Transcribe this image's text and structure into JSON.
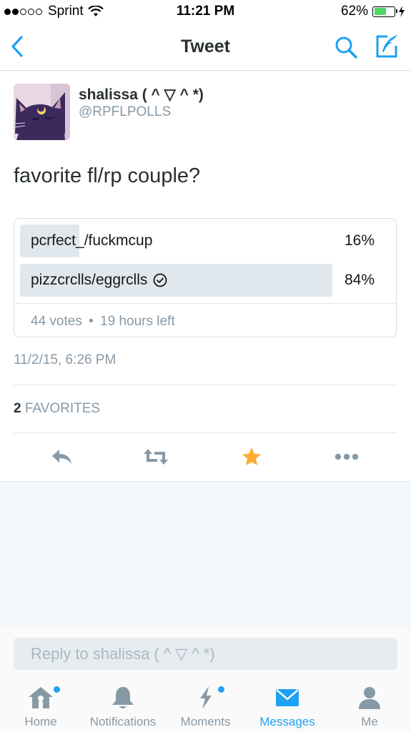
{
  "status_bar": {
    "carrier": "Sprint",
    "time": "11:21 PM",
    "battery_percent": "62%",
    "battery_level": 0.62,
    "signal_bars_filled": 2,
    "signal_bars_total": 5
  },
  "nav": {
    "title": "Tweet",
    "back_icon": "chevron-left-icon",
    "search_icon": "search-icon",
    "compose_icon": "compose-icon",
    "accent_color": "#1da1f2"
  },
  "tweet": {
    "display_name": "shalissa ( ^ ▽ ^ *)",
    "handle": "@RPFLPOLLS",
    "text": "favorite fl/rp couple?",
    "timestamp": "11/2/15, 6:26 PM",
    "favorites_count": "2",
    "favorites_label": "FAVORITES"
  },
  "poll": {
    "options": [
      {
        "label": "pcrfect_/fuckmcup",
        "percent_text": "16%",
        "percent": 16,
        "winner": false
      },
      {
        "label": "pizzcrclls/eggrclls",
        "percent_text": "84%",
        "percent": 84,
        "winner": true
      }
    ],
    "votes": "44 votes",
    "time_left": "19 hours left",
    "separator": "•"
  },
  "actions": {
    "reply_icon": "reply-icon",
    "retweet_icon": "retweet-icon",
    "favorite_icon": "star-icon",
    "favorite_color": "#ffac33",
    "more_icon": "more-icon"
  },
  "reply": {
    "placeholder": "Reply to shalissa ( ^ ▽ ^ *)"
  },
  "tab_bar": {
    "tabs": [
      {
        "label": "Home",
        "icon": "home-icon",
        "active": false,
        "has_dot": true
      },
      {
        "label": "Notifications",
        "icon": "bell-icon",
        "active": false,
        "has_dot": false
      },
      {
        "label": "Moments",
        "icon": "lightning-icon",
        "active": false,
        "has_dot": true
      },
      {
        "label": "Messages",
        "icon": "envelope-icon",
        "active": true,
        "has_dot": false
      },
      {
        "label": "Me",
        "icon": "person-icon",
        "active": false,
        "has_dot": false
      }
    ]
  }
}
